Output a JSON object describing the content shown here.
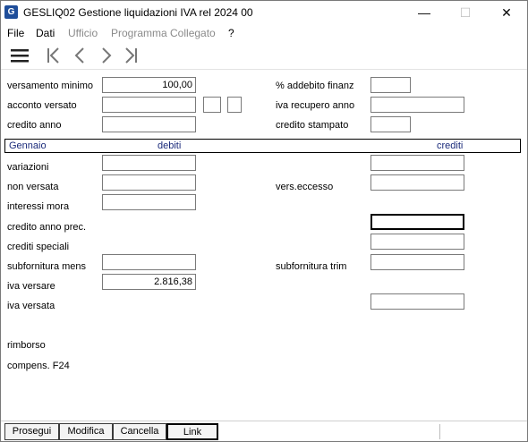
{
  "titlebar": {
    "icon_letter": "G",
    "title": "GESLIQ02  Gestione liquidazioni IVA rel 2024 00",
    "min": "—",
    "max": "☐",
    "close": "✕"
  },
  "menu": {
    "file": "File",
    "dati": "Dati",
    "ufficio": "Ufficio",
    "programma": "Programma Collegato",
    "help": "?"
  },
  "toolbar": {
    "menu_icon": "hamburger-icon",
    "first_icon": "first-icon",
    "prev_icon": "prev-icon",
    "next_icon": "next-icon",
    "last_icon": "last-icon"
  },
  "top": {
    "versamento_minimo": {
      "label": "versamento minimo",
      "value": "100,00"
    },
    "acconto_versato": {
      "label": "acconto versato",
      "value": ""
    },
    "credito_anno": {
      "label": "credito anno",
      "value": ""
    },
    "addebito_finanz": {
      "label": "% addebito finanz",
      "value": ""
    },
    "iva_recupero_anno": {
      "label": "iva recupero anno",
      "value": ""
    },
    "credito_stampato": {
      "label": "credito stampato",
      "value": ""
    }
  },
  "section": {
    "month": "Gennaio",
    "debiti": "debiti",
    "crediti": "crediti"
  },
  "rows": {
    "variazioni": "variazioni",
    "non_versata": "non versata",
    "vers_eccesso": "vers.eccesso",
    "interessi_mora": "interessi mora",
    "credito_anno_prec": "credito anno prec.",
    "crediti_speciali": "crediti speciali",
    "subfornitura_mens": "subfornitura mens",
    "subfornitura_trim": "subfornitura trim",
    "iva_versare": "iva versare",
    "iva_versare_value": "2.816,38",
    "iva_versata": "iva versata",
    "rimborso": "rimborso",
    "compens_f24": "compens. F24"
  },
  "buttons": {
    "prosegui": "Prosegui",
    "modifica": "Modifica",
    "cancella": "Cancella",
    "link": "Link"
  }
}
